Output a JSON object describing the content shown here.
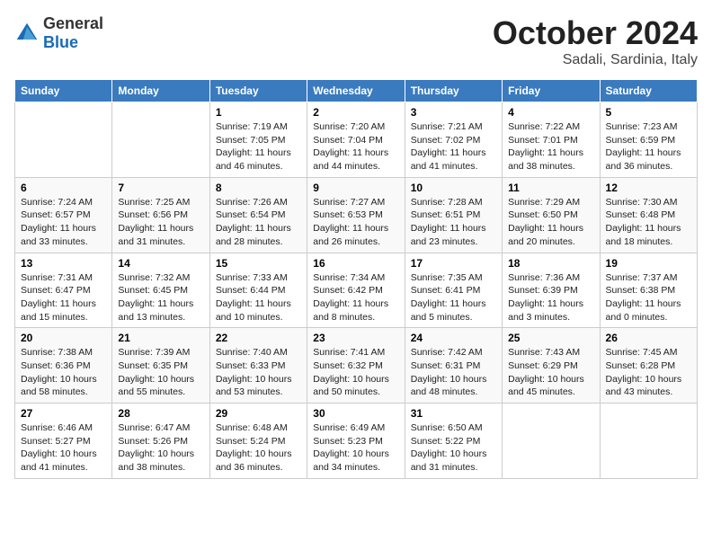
{
  "header": {
    "logo_general": "General",
    "logo_blue": "Blue",
    "month": "October 2024",
    "location": "Sadali, Sardinia, Italy"
  },
  "days_of_week": [
    "Sunday",
    "Monday",
    "Tuesday",
    "Wednesday",
    "Thursday",
    "Friday",
    "Saturday"
  ],
  "weeks": [
    [
      {
        "day": "",
        "sunrise": "",
        "sunset": "",
        "daylight": ""
      },
      {
        "day": "",
        "sunrise": "",
        "sunset": "",
        "daylight": ""
      },
      {
        "day": "1",
        "sunrise": "Sunrise: 7:19 AM",
        "sunset": "Sunset: 7:05 PM",
        "daylight": "Daylight: 11 hours and 46 minutes."
      },
      {
        "day": "2",
        "sunrise": "Sunrise: 7:20 AM",
        "sunset": "Sunset: 7:04 PM",
        "daylight": "Daylight: 11 hours and 44 minutes."
      },
      {
        "day": "3",
        "sunrise": "Sunrise: 7:21 AM",
        "sunset": "Sunset: 7:02 PM",
        "daylight": "Daylight: 11 hours and 41 minutes."
      },
      {
        "day": "4",
        "sunrise": "Sunrise: 7:22 AM",
        "sunset": "Sunset: 7:01 PM",
        "daylight": "Daylight: 11 hours and 38 minutes."
      },
      {
        "day": "5",
        "sunrise": "Sunrise: 7:23 AM",
        "sunset": "Sunset: 6:59 PM",
        "daylight": "Daylight: 11 hours and 36 minutes."
      }
    ],
    [
      {
        "day": "6",
        "sunrise": "Sunrise: 7:24 AM",
        "sunset": "Sunset: 6:57 PM",
        "daylight": "Daylight: 11 hours and 33 minutes."
      },
      {
        "day": "7",
        "sunrise": "Sunrise: 7:25 AM",
        "sunset": "Sunset: 6:56 PM",
        "daylight": "Daylight: 11 hours and 31 minutes."
      },
      {
        "day": "8",
        "sunrise": "Sunrise: 7:26 AM",
        "sunset": "Sunset: 6:54 PM",
        "daylight": "Daylight: 11 hours and 28 minutes."
      },
      {
        "day": "9",
        "sunrise": "Sunrise: 7:27 AM",
        "sunset": "Sunset: 6:53 PM",
        "daylight": "Daylight: 11 hours and 26 minutes."
      },
      {
        "day": "10",
        "sunrise": "Sunrise: 7:28 AM",
        "sunset": "Sunset: 6:51 PM",
        "daylight": "Daylight: 11 hours and 23 minutes."
      },
      {
        "day": "11",
        "sunrise": "Sunrise: 7:29 AM",
        "sunset": "Sunset: 6:50 PM",
        "daylight": "Daylight: 11 hours and 20 minutes."
      },
      {
        "day": "12",
        "sunrise": "Sunrise: 7:30 AM",
        "sunset": "Sunset: 6:48 PM",
        "daylight": "Daylight: 11 hours and 18 minutes."
      }
    ],
    [
      {
        "day": "13",
        "sunrise": "Sunrise: 7:31 AM",
        "sunset": "Sunset: 6:47 PM",
        "daylight": "Daylight: 11 hours and 15 minutes."
      },
      {
        "day": "14",
        "sunrise": "Sunrise: 7:32 AM",
        "sunset": "Sunset: 6:45 PM",
        "daylight": "Daylight: 11 hours and 13 minutes."
      },
      {
        "day": "15",
        "sunrise": "Sunrise: 7:33 AM",
        "sunset": "Sunset: 6:44 PM",
        "daylight": "Daylight: 11 hours and 10 minutes."
      },
      {
        "day": "16",
        "sunrise": "Sunrise: 7:34 AM",
        "sunset": "Sunset: 6:42 PM",
        "daylight": "Daylight: 11 hours and 8 minutes."
      },
      {
        "day": "17",
        "sunrise": "Sunrise: 7:35 AM",
        "sunset": "Sunset: 6:41 PM",
        "daylight": "Daylight: 11 hours and 5 minutes."
      },
      {
        "day": "18",
        "sunrise": "Sunrise: 7:36 AM",
        "sunset": "Sunset: 6:39 PM",
        "daylight": "Daylight: 11 hours and 3 minutes."
      },
      {
        "day": "19",
        "sunrise": "Sunrise: 7:37 AM",
        "sunset": "Sunset: 6:38 PM",
        "daylight": "Daylight: 11 hours and 0 minutes."
      }
    ],
    [
      {
        "day": "20",
        "sunrise": "Sunrise: 7:38 AM",
        "sunset": "Sunset: 6:36 PM",
        "daylight": "Daylight: 10 hours and 58 minutes."
      },
      {
        "day": "21",
        "sunrise": "Sunrise: 7:39 AM",
        "sunset": "Sunset: 6:35 PM",
        "daylight": "Daylight: 10 hours and 55 minutes."
      },
      {
        "day": "22",
        "sunrise": "Sunrise: 7:40 AM",
        "sunset": "Sunset: 6:33 PM",
        "daylight": "Daylight: 10 hours and 53 minutes."
      },
      {
        "day": "23",
        "sunrise": "Sunrise: 7:41 AM",
        "sunset": "Sunset: 6:32 PM",
        "daylight": "Daylight: 10 hours and 50 minutes."
      },
      {
        "day": "24",
        "sunrise": "Sunrise: 7:42 AM",
        "sunset": "Sunset: 6:31 PM",
        "daylight": "Daylight: 10 hours and 48 minutes."
      },
      {
        "day": "25",
        "sunrise": "Sunrise: 7:43 AM",
        "sunset": "Sunset: 6:29 PM",
        "daylight": "Daylight: 10 hours and 45 minutes."
      },
      {
        "day": "26",
        "sunrise": "Sunrise: 7:45 AM",
        "sunset": "Sunset: 6:28 PM",
        "daylight": "Daylight: 10 hours and 43 minutes."
      }
    ],
    [
      {
        "day": "27",
        "sunrise": "Sunrise: 6:46 AM",
        "sunset": "Sunset: 5:27 PM",
        "daylight": "Daylight: 10 hours and 41 minutes."
      },
      {
        "day": "28",
        "sunrise": "Sunrise: 6:47 AM",
        "sunset": "Sunset: 5:26 PM",
        "daylight": "Daylight: 10 hours and 38 minutes."
      },
      {
        "day": "29",
        "sunrise": "Sunrise: 6:48 AM",
        "sunset": "Sunset: 5:24 PM",
        "daylight": "Daylight: 10 hours and 36 minutes."
      },
      {
        "day": "30",
        "sunrise": "Sunrise: 6:49 AM",
        "sunset": "Sunset: 5:23 PM",
        "daylight": "Daylight: 10 hours and 34 minutes."
      },
      {
        "day": "31",
        "sunrise": "Sunrise: 6:50 AM",
        "sunset": "Sunset: 5:22 PM",
        "daylight": "Daylight: 10 hours and 31 minutes."
      },
      {
        "day": "",
        "sunrise": "",
        "sunset": "",
        "daylight": ""
      },
      {
        "day": "",
        "sunrise": "",
        "sunset": "",
        "daylight": ""
      }
    ]
  ]
}
